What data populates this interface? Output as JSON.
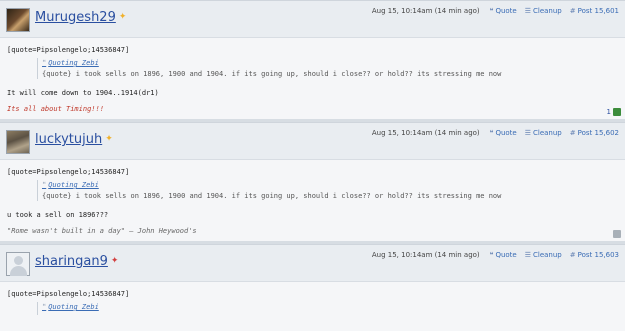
{
  "actions": {
    "quote_label": "Quote",
    "cleanup_label": "Cleanup"
  },
  "posts": [
    {
      "username": "Murugesh29",
      "online_icon": "star-icon",
      "time": "Aug 15, 10:14am (14 min ago)",
      "post_number": "Post 15,601",
      "quote_tag": "[quote=Pipsolengelo;14536847]",
      "quote_header": "Quoting Zebi",
      "quote_text": "{quote} i took sells on 1896, 1900 and 1904. if its going up, should i close?? or hold?? its stressing me now",
      "body": "It will come down to 1904..1914(dr1)",
      "signature": "Its all about Timing!!!",
      "like_count": "1"
    },
    {
      "username": "luckytujuh",
      "online_icon": "star-icon",
      "time": "Aug 15, 10:14am (14 min ago)",
      "post_number": "Post 15,602",
      "quote_tag": "[quote=Pipsolengelo;14536847]",
      "quote_header": "Quoting Zebi",
      "quote_text": "{quote} i took sells on 1896, 1900 and 1904. if its going up, should i close?? or hold?? its stressing me now",
      "body": "u took a sell on 1896???",
      "signature": "\"Rome wasn't built in a day\" — John Heywood's",
      "like_count": ""
    },
    {
      "username": "sharingan9",
      "online_icon": "offline-icon",
      "time": "Aug 15, 10:14am (14 min ago)",
      "post_number": "Post 15,603",
      "quote_tag": "[quote=Pipsolengelo;14536847]",
      "quote_header": "Quoting Zebi"
    }
  ]
}
